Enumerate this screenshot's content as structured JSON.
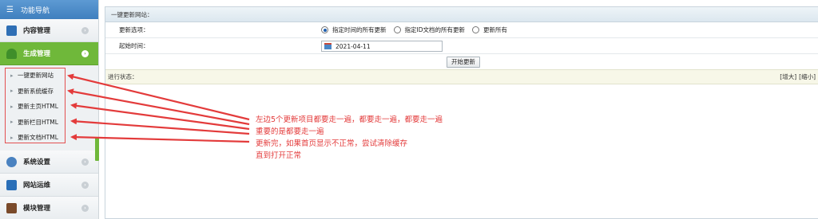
{
  "sidebar": {
    "header": "功能导航",
    "menu": [
      {
        "label": "内容管理",
        "icon": "pencil-icon",
        "color": "#2f6fb5"
      },
      {
        "label": "生成管理",
        "icon": "tree-icon",
        "color": "#3f8f2a"
      }
    ],
    "sub_items": [
      "一键更新网站",
      "更新系统缓存",
      "更新主页HTML",
      "更新栏目HTML",
      "更新文档HTML"
    ],
    "menu_bottom": [
      {
        "label": "系统设置",
        "icon": "gear-icon",
        "color": "#4a82c0"
      },
      {
        "label": "网站运维",
        "icon": "monitor-icon",
        "color": "#2a6fb8"
      },
      {
        "label": "模块管理",
        "icon": "book-icon",
        "color": "#7a4a2a"
      }
    ]
  },
  "main": {
    "title": "一键更新网站：",
    "update_label": "更新选项：",
    "options": [
      "指定时间的所有更新",
      "指定ID文档的所有更新",
      "更新所有"
    ],
    "selected_option": "指定时间的所有更新",
    "start_time_label": "起始时间：",
    "start_time_value": "2021-04-11",
    "start_button": "开始更新",
    "status_label": "进行状态：",
    "zoom_in": "[增大]",
    "zoom_out": "[缩小]"
  },
  "annotation": {
    "lines": [
      "左边5个更新项目都要走一遍，都要走一遍，都要走一遍",
      "重要的是都要走一遍",
      "更新完，如果首页显示不正常，尝试清除缓存",
      "直到打开正常"
    ],
    "color": "#e33b3b"
  }
}
